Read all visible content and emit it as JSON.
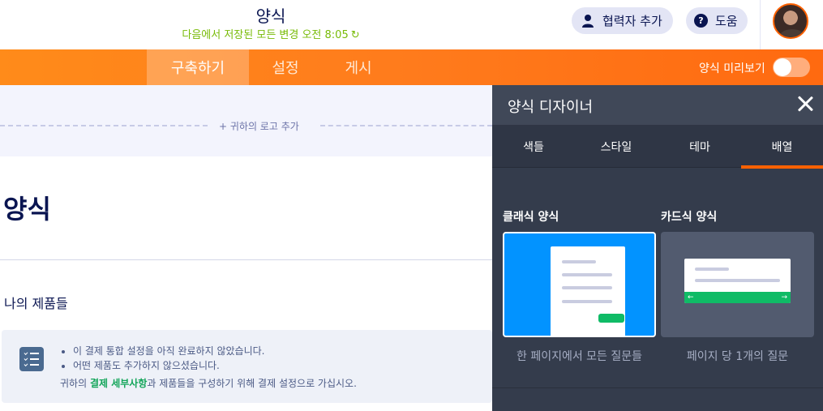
{
  "header": {
    "form_title": "양식",
    "save_status": "다음에서 저장된 모든 변경 오전 8:05",
    "add_collaborator": "협력자 추가",
    "help": "도움",
    "help_icon_glyph": "?"
  },
  "nav": {
    "tabs": [
      {
        "label": "구축하기",
        "active": true
      },
      {
        "label": "설정",
        "active": false
      },
      {
        "label": "게시",
        "active": false
      }
    ],
    "preview_label": "양식 미리보기",
    "preview_enabled": false,
    "accent_color": "#ff6100"
  },
  "form": {
    "add_logo": "+ 귀하의 로고 추가",
    "heading": "양식",
    "products_label": "나의 제품들",
    "notice": {
      "bullets": [
        "이 결제 통합 설정을 아직 완료하지 않았습니다.",
        "어떤 제품도 추가하지 않으셨습니다."
      ],
      "prefix": "귀하의 ",
      "link": "결제 세부사항",
      "suffix": "과 제품들을 구성하기 위해 결제 설정으로 가십시오."
    }
  },
  "designer": {
    "title": "양식 디자이너",
    "tabs": [
      {
        "label": "색들",
        "active": false
      },
      {
        "label": "스타일",
        "active": false
      },
      {
        "label": "테마",
        "active": false
      },
      {
        "label": "배열",
        "active": true
      }
    ],
    "layouts": [
      {
        "title": "클래식 양식",
        "description": "한 페이지에서 모든 질문들",
        "selected": true
      },
      {
        "title": "카드식 양식",
        "description": "페이지 당 1개의 질문",
        "selected": false
      }
    ]
  }
}
